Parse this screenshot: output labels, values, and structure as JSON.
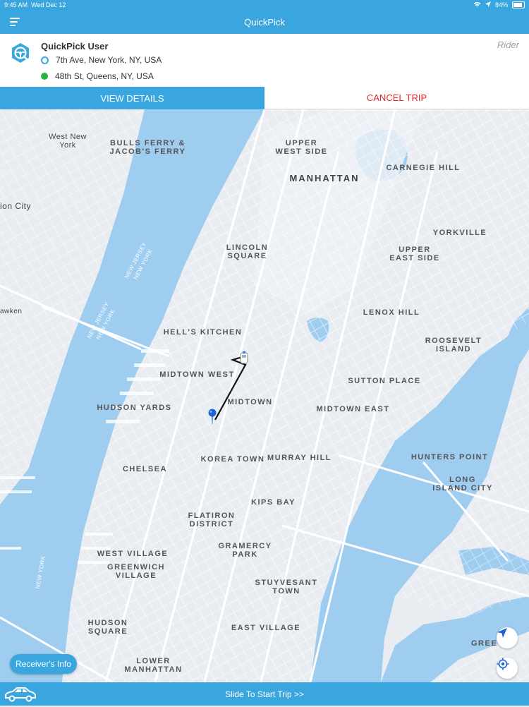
{
  "status": {
    "time": "9:45 AM",
    "date": "Wed Dec 12",
    "battery": "84%",
    "battery_level": 0.84
  },
  "nav": {
    "title": "QuickPick",
    "menu_icon": "menu-icon"
  },
  "trip": {
    "user_name": "QuickPick User",
    "role": "Rider",
    "from": "7th Ave, New York, NY, USA",
    "to": "48th St, Queens, NY, USA"
  },
  "actions": {
    "view_details": "VIEW DETAILS",
    "cancel_trip": "CANCEL TRIP"
  },
  "map_labels": {
    "west_new_york": "West New\nYork",
    "bulls_ferry": "BULLS FERRY &\nJACOB'S FERRY",
    "upper_west_side": "UPPER\nWEST SIDE",
    "manhattan": "MANHATTAN",
    "carnegie_hill": "CARNEGIE HILL",
    "union_city": "ion City",
    "yorkville": "YORKVILLE",
    "lincoln_square": "LINCOLN\nSQUARE",
    "upper_east_side": "UPPER\nEAST SIDE",
    "new_jersey_ny_1": "NEW JERSEY\nNEW YORK",
    "weehawken": "awken",
    "lenox_hill": "LENOX HILL",
    "new_jersey_ny_2": "NEW JERSEY\nNEW YORK",
    "hells_kitchen": "HELL'S KITCHEN",
    "roosevelt_island": "ROOSEVELT\nISLAND",
    "midtown_west": "MIDTOWN WEST",
    "sutton_place": "SUTTON PLACE",
    "hudson_yards": "HUDSON YARDS",
    "midtown": "MIDTOWN",
    "midtown_east": "MIDTOWN EAST",
    "hunters_point": "HUNTERS POINT",
    "chelsea": "CHELSEA",
    "korea_town": "KOREA TOWN",
    "murray_hill": "MURRAY HILL",
    "long_island_city": "LONG\nISLAND CITY",
    "kips_bay": "KIPS BAY",
    "flatiron": "FLATIRON\nDISTRICT",
    "gramercy": "GRAMERCY PARK",
    "west_village": "WEST VILLAGE",
    "greenwich_village": "GREENWICH\nVILLAGE",
    "new_york_water": "NEW YORK",
    "stuyvesant": "STUYVESANT\nTOWN",
    "hudson_square": "HUDSON\nSQUARE",
    "east_village": "EAST VILLAGE",
    "greenpoint": "GREE",
    "lower_manhattan": "LOWER\nMANHATTAN"
  },
  "receiver_info": "Receiver's Info",
  "bottom": {
    "slide": "Slide To Start Trip >>"
  },
  "colors": {
    "accent": "#3aa6e0",
    "cancel": "#e0282a",
    "water": "#9fcdf0",
    "pickup_dot": "#28b33a"
  }
}
